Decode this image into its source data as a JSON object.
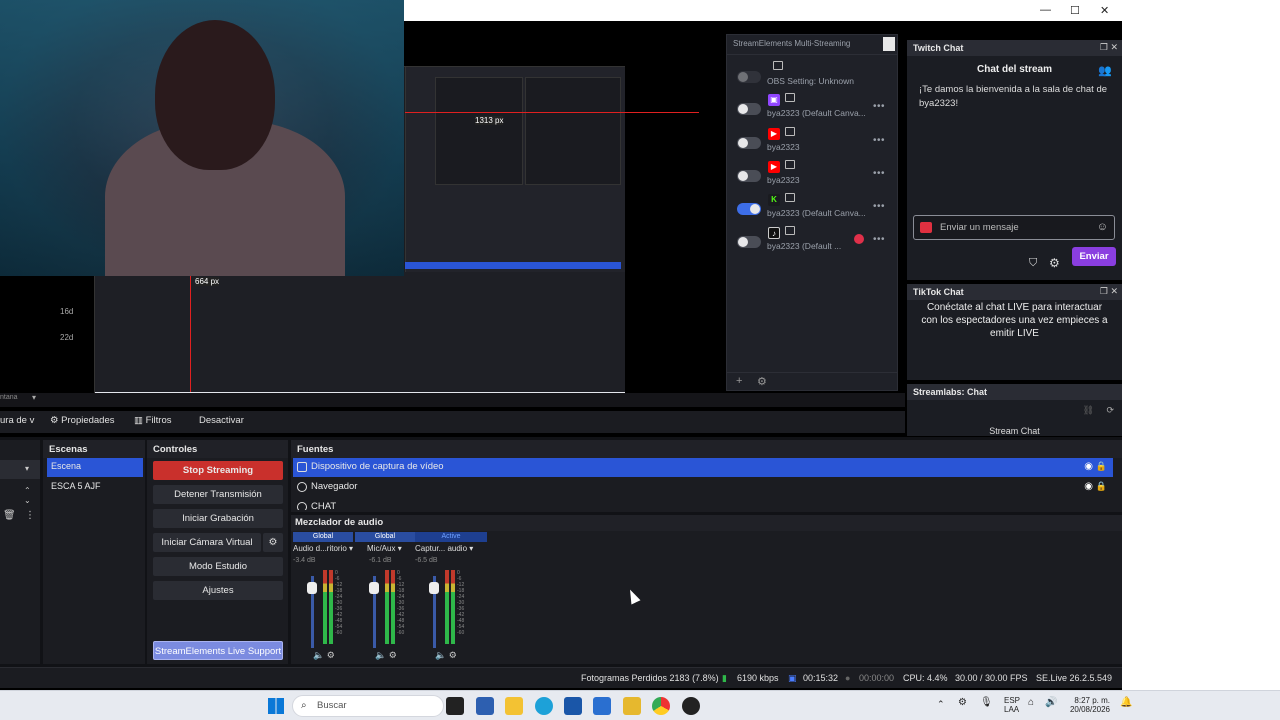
{
  "window": {
    "minimize": "—",
    "maximize": "☐",
    "close": "✕"
  },
  "preview": {
    "nested_labels": [
      "1313 px",
      "664 px"
    ],
    "side_labels": [
      "16d",
      "22d"
    ]
  },
  "multistream": {
    "title": "StreamElements Multi-Streaming",
    "rows": [
      {
        "label": "OBS Setting: Unknown",
        "platform": "none",
        "enabled": false
      },
      {
        "label": "bya2323 (Default Canva...",
        "platform": "twitch",
        "enabled": false
      },
      {
        "label": "bya2323",
        "platform": "youtube",
        "enabled": false
      },
      {
        "label": "bya2323",
        "platform": "youtube",
        "enabled": false
      },
      {
        "label": "bya2323 (Default Canva...",
        "platform": "kick",
        "enabled": true
      },
      {
        "label": "bya2323 (Default ...",
        "platform": "tiktok",
        "enabled": false
      }
    ]
  },
  "twitch_chat": {
    "title": "Twitch Chat",
    "header": "Chat del stream",
    "welcome": "¡Te damos la bienvenida a la sala de chat de bya2323!",
    "input_placeholder": "Enviar un mensaje",
    "send_label": "Enviar"
  },
  "tiktok_chat": {
    "title": "TikTok Chat",
    "message": "Conéctate al chat LIVE para interactuar con los espectadores una vez empieces a emitir LIVE"
  },
  "streamlabs_chat": {
    "title": "Streamlabs: Chat",
    "header": "Stream Chat"
  },
  "toolbar": {
    "source_name": "ura de v",
    "properties": "Propiedades",
    "filters": "Filtros",
    "deactivate": "Desactivar",
    "truncated": "ntana"
  },
  "scenes": {
    "title": "Escenas",
    "items": [
      "Escena",
      "ESCA 5 AJF"
    ]
  },
  "controls": {
    "title": "Controles",
    "buttons": [
      "Stop Streaming",
      "Detener Transmisión",
      "Iniciar Grabación",
      "Iniciar Cámara Virtual",
      "Modo Estudio",
      "Ajustes"
    ],
    "support": "StreamElements Live Support"
  },
  "sources": {
    "title": "Fuentes",
    "items": [
      "Dispositivo de captura de vídeo",
      "Navegador",
      "CHAT"
    ]
  },
  "mixer": {
    "title": "Mezclador de audio",
    "channels": [
      {
        "tag": "Global",
        "name": "Audio d...ritorio",
        "db": "-3.4 dB"
      },
      {
        "tag": "Global",
        "name": "Mic/Aux",
        "db": "-6.1 dB"
      },
      {
        "tag": "Active",
        "name": "Captur... audio",
        "db": "-6.5 dB"
      }
    ],
    "scale": [
      "0",
      "-6",
      "-12",
      "-18",
      "-24",
      "-30",
      "-36",
      "-42",
      "-48",
      "-54",
      "-60"
    ]
  },
  "status": {
    "dropped": "Fotogramas Perdidos 2183 (7.8%)",
    "bitrate": "6190 kbps",
    "stream_time": "00:15:32",
    "rec_time": "00:00:00",
    "cpu": "CPU: 4.4%",
    "fps": "30.00 / 30.00 FPS",
    "version": "SE.Live 26.2.5.549"
  },
  "taskbar": {
    "search": "Buscar",
    "lang": "ESP",
    "lang2": "LAA",
    "time": "8:27 p. m.",
    "date": "20/08/2026"
  },
  "colors": {
    "accent": "#2a55d6",
    "stop": "#c9302c",
    "send": "#8a3ee0"
  }
}
